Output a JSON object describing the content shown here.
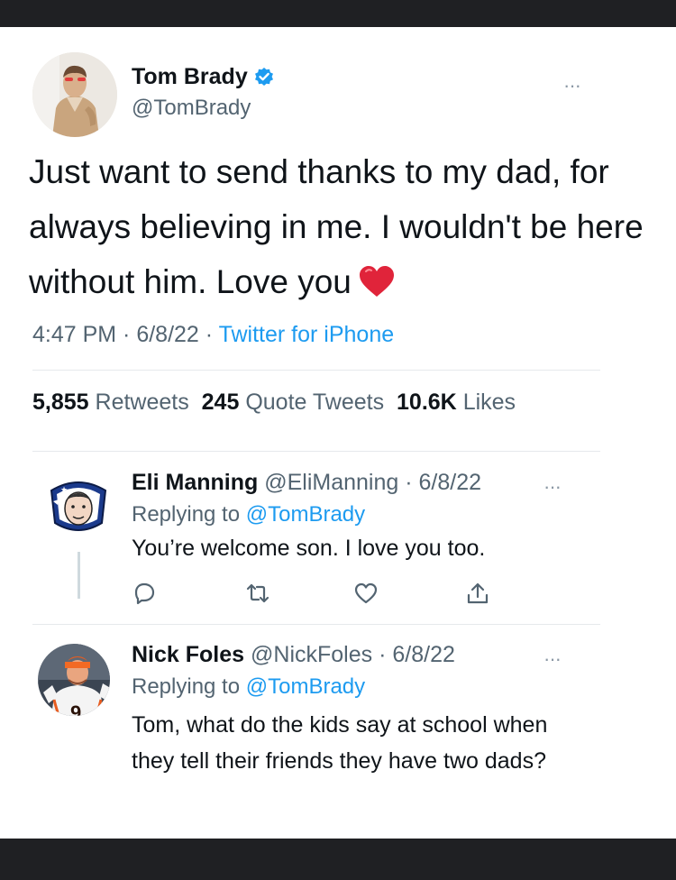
{
  "main_tweet": {
    "name": "Tom Brady",
    "handle": "@TomBrady",
    "text": "Just want to send thanks to my dad, for always believing in me. I wouldn't be here without him. Love you",
    "time": "4:47 PM",
    "date": "6/8/22",
    "source": "Twitter for iPhone",
    "separator": " · ",
    "stats": {
      "retweets_count": "5,855",
      "retweets_label": "Retweets",
      "quotes_count": "245",
      "quotes_label": "Quote Tweets",
      "likes_count": "10.6K",
      "likes_label": "Likes"
    },
    "more_label": "···"
  },
  "replies": [
    {
      "name": "Eli Manning",
      "handle": "@EliManning",
      "date": "· 6/8/22",
      "replying_prefix": "Replying to",
      "replying_to": "@TomBrady",
      "text": "You’re welcome son. I love you too.",
      "more_label": "···"
    },
    {
      "name": "Nick Foles",
      "handle": "@NickFoles",
      "date": "· 6/8/22",
      "replying_prefix": "Replying to",
      "replying_to": "@TomBrady",
      "text": "Tom, what do the kids say at school when they tell their friends they have two dads?",
      "jersey_number": "9",
      "more_label": "···"
    }
  ],
  "icons": [
    "verified-badge-icon",
    "heart-emoji-icon",
    "reply-icon",
    "retweet-icon",
    "like-icon",
    "share-icon"
  ],
  "colors": {
    "link_blue": "#1d9bf0",
    "secondary_text": "#536471",
    "primary_text": "#0f1419",
    "frame_dark": "#1f2023",
    "heart_red": "#e0243a"
  }
}
